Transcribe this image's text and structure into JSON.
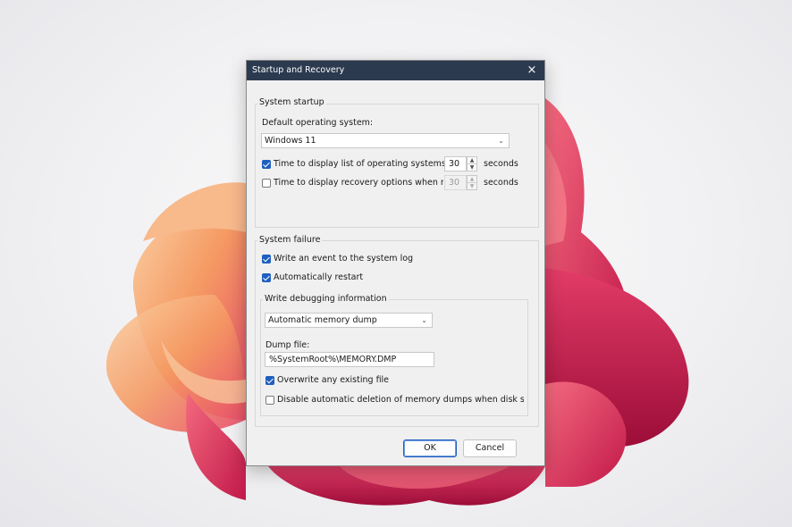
{
  "dialog": {
    "title": "Startup and Recovery",
    "close_icon": "×"
  },
  "system_startup": {
    "group_label": "System startup",
    "default_os_label": "Default operating system:",
    "default_os_value": "Windows 11",
    "display_list": {
      "label": "Time to display list of operating systems:",
      "checked": true,
      "value": "30",
      "unit": "seconds"
    },
    "recovery_options": {
      "label": "Time to display recovery options when needed",
      "checked": false,
      "value": "30",
      "unit": "seconds"
    }
  },
  "system_failure": {
    "group_label": "System failure",
    "write_event": {
      "label": "Write an event to the system log",
      "checked": true
    },
    "auto_restart": {
      "label": "Automatically restart",
      "checked": true
    },
    "debug": {
      "group_label": "Write debugging information",
      "dump_type": "Automatic memory dump",
      "dump_file_label": "Dump file:",
      "dump_file_value": "%SystemRoot%\\MEMORY.DMP",
      "overwrite": {
        "label": "Overwrite any existing file",
        "checked": true
      },
      "disable_deletion": {
        "label": "Disable automatic deletion of memory dumps when disk space is l",
        "checked": false
      }
    }
  },
  "buttons": {
    "ok": "OK",
    "cancel": "Cancel"
  },
  "colors": {
    "titlebar": "#2b3a4f",
    "accent": "#1f5fbf",
    "dialog_bg": "#f0f0f0"
  }
}
